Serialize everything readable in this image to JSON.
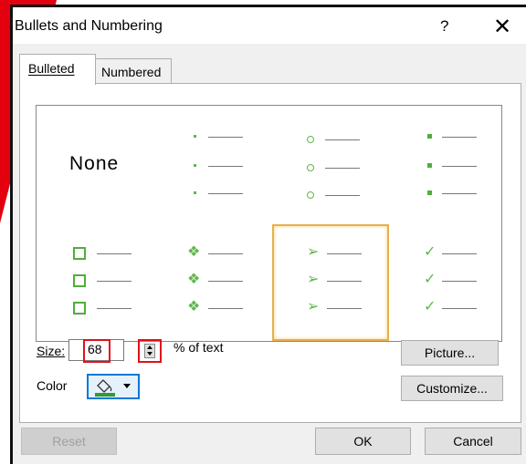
{
  "dialog": {
    "title": "Bullets and Numbering",
    "help_label": "?",
    "close_label": "✕"
  },
  "tabs": [
    {
      "label": "Bulleted",
      "active": true
    },
    {
      "label": "Numbered",
      "active": false
    }
  ],
  "gallery": {
    "none_label": "None",
    "selected_style": "arrow",
    "styles": [
      "none",
      "small-dot",
      "hollow-circle",
      "filled-square",
      "hollow-square",
      "diamond-dots",
      "arrow",
      "checkmark"
    ],
    "bullet_color": "#5fb74d"
  },
  "size": {
    "label": "Size:",
    "value": "68",
    "suffix": "% of text"
  },
  "color": {
    "label": "Color",
    "icon": "paint-bucket-icon",
    "swatch": "#2e9b3a"
  },
  "buttons": {
    "picture": "Picture...",
    "customize": "Customize...",
    "reset": "Reset",
    "ok": "OK",
    "cancel": "Cancel"
  },
  "highlight_color": "#e0101a"
}
